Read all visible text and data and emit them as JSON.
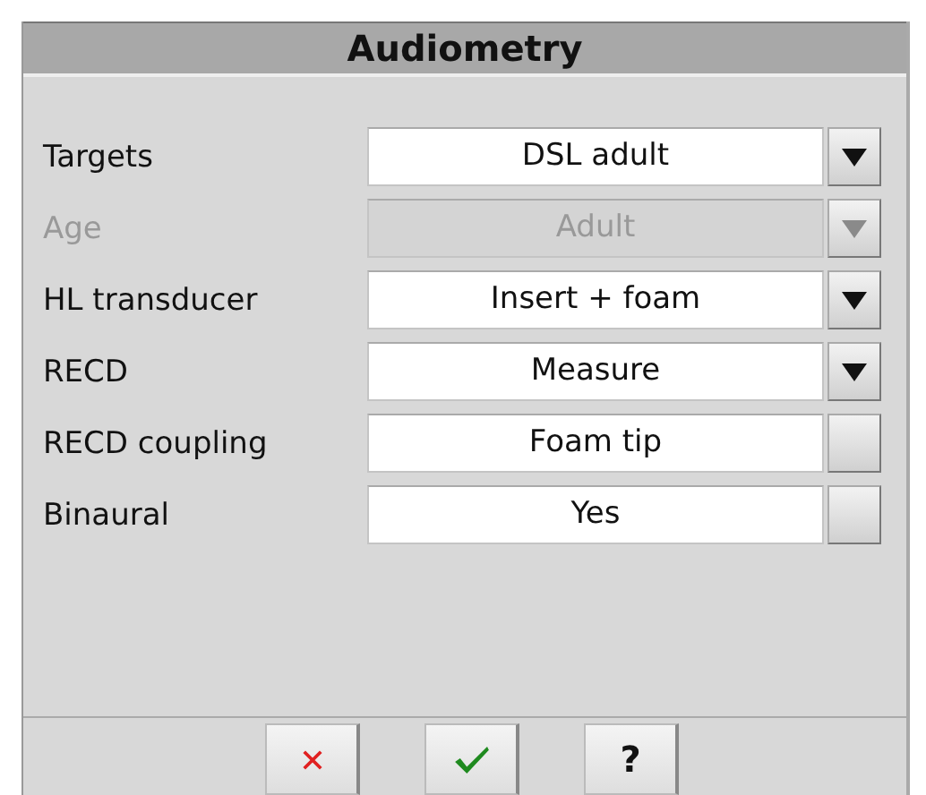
{
  "window": {
    "title": "Audiometry"
  },
  "rows": [
    {
      "label": "Targets",
      "value": "DSL adult",
      "kind": "dropdown",
      "disabled": false
    },
    {
      "label": "Age",
      "value": "Adult",
      "kind": "dropdown",
      "disabled": true
    },
    {
      "label": "HL transducer",
      "value": "Insert + foam",
      "kind": "dropdown",
      "disabled": false
    },
    {
      "label": "RECD",
      "value": "Measure",
      "kind": "dropdown",
      "disabled": false
    },
    {
      "label": "RECD coupling",
      "value": "Foam tip",
      "kind": "toggle",
      "disabled": false
    },
    {
      "label": "Binaural",
      "value": "Yes",
      "kind": "toggle",
      "disabled": false
    }
  ],
  "buttons": [
    {
      "kind": "cancel"
    },
    {
      "kind": "ok"
    },
    {
      "kind": "help",
      "label": "?"
    }
  ]
}
